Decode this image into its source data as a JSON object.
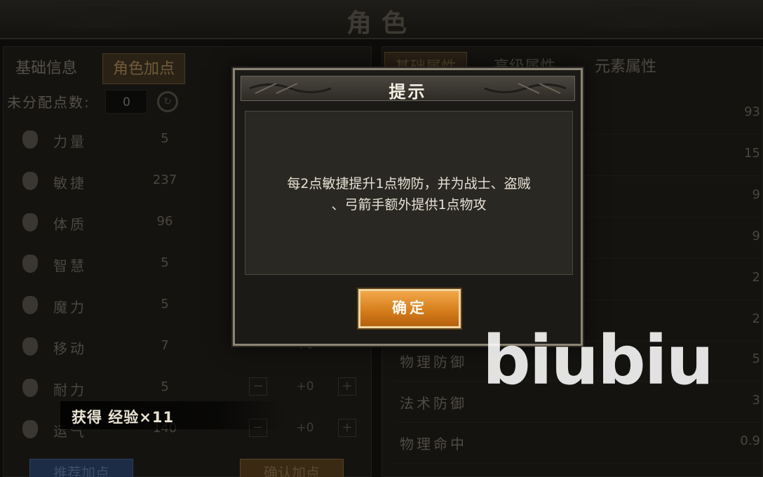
{
  "window": {
    "title": "角色"
  },
  "left": {
    "tabs": [
      {
        "label": "基础信息",
        "active": false
      },
      {
        "label": "角色加点",
        "active": true
      }
    ],
    "unallocated_label": "未分配点数:",
    "unallocated_value": "0",
    "stats": [
      {
        "name": "力量",
        "value": "5",
        "icon": "strength-icon"
      },
      {
        "name": "敏捷",
        "value": "237",
        "icon": "agility-icon"
      },
      {
        "name": "体质",
        "value": "96",
        "icon": "constitution-icon"
      },
      {
        "name": "智慧",
        "value": "5",
        "icon": "wisdom-icon"
      },
      {
        "name": "魔力",
        "value": "5",
        "icon": "magic-icon"
      },
      {
        "name": "移动",
        "value": "7",
        "delta": "+0",
        "icon": "movement-icon"
      },
      {
        "name": "耐力",
        "value": "5",
        "delta": "+0",
        "icon": "stamina-icon"
      },
      {
        "name": "运气",
        "value": "140",
        "delta": "+0",
        "icon": "luck-icon"
      }
    ],
    "buttons": {
      "recommend": "推荐加点",
      "confirm": "确认加点"
    }
  },
  "right": {
    "tabs": [
      {
        "label": "基础属性",
        "active": true
      },
      {
        "label": "高级属性",
        "active": false
      },
      {
        "label": "元素属性",
        "active": false
      }
    ],
    "rows": [
      {
        "name": "",
        "value": "93"
      },
      {
        "name": "",
        "value": "15"
      },
      {
        "name": "",
        "value": "9"
      },
      {
        "name": "",
        "value": "9"
      },
      {
        "name": "",
        "value": "2"
      },
      {
        "name": "",
        "value": "2"
      },
      {
        "name": "物理防御",
        "value": "5"
      },
      {
        "name": "法术防御",
        "value": "3"
      },
      {
        "name": "物理命中",
        "value": "0.9"
      }
    ]
  },
  "toast": {
    "text": "获得 经验×11"
  },
  "modal": {
    "title": "提示",
    "message_line1": "每2点敏捷提升1点物防，并为战士、盗贼",
    "message_line2": "、弓箭手额外提供1点物攻",
    "ok_label": "确定"
  },
  "watermark": "biubiu",
  "colors": {
    "accent": "#d37a1a",
    "modal_border": "#8c8473",
    "text_light": "#e6e1d4"
  }
}
